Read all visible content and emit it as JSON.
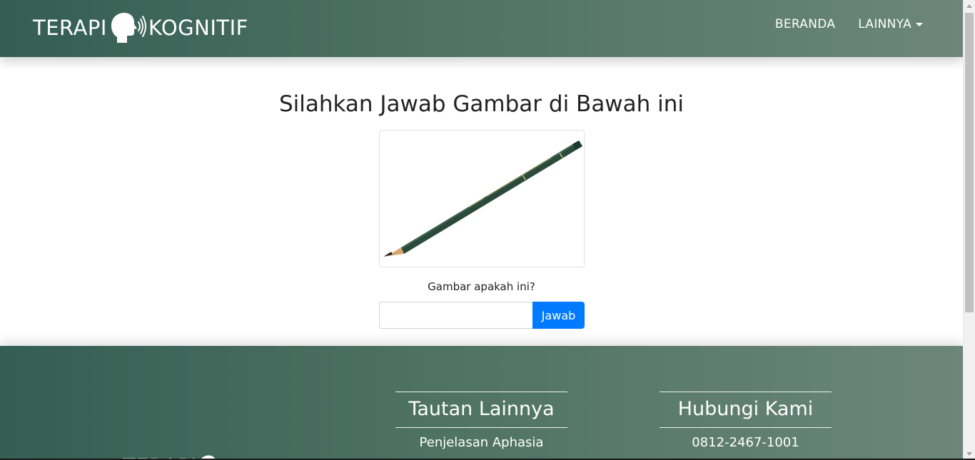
{
  "navbar": {
    "brand_left": "TERAPI",
    "brand_right": "KOGNITIF",
    "links": [
      {
        "label": "BERANDA"
      },
      {
        "label": "LAINNYA"
      }
    ]
  },
  "main": {
    "title": "Silahkan Jawab Gambar di Bawah ini",
    "question": "Gambar apakah ini?",
    "answer_value": "",
    "submit_label": "Jawab"
  },
  "footer": {
    "logo_text": "TERAPI",
    "columns": [
      {
        "heading": "Tautan Lainnya",
        "items": [
          "Penjelasan Aphasia"
        ]
      },
      {
        "heading": "Hubungi Kami",
        "items": [
          "0812-2467-1001"
        ]
      }
    ]
  },
  "colors": {
    "gradient_start": "#345e52",
    "gradient_end": "#6c8779",
    "button_primary": "#007bff",
    "pencil_green": "#2c4a3b"
  }
}
